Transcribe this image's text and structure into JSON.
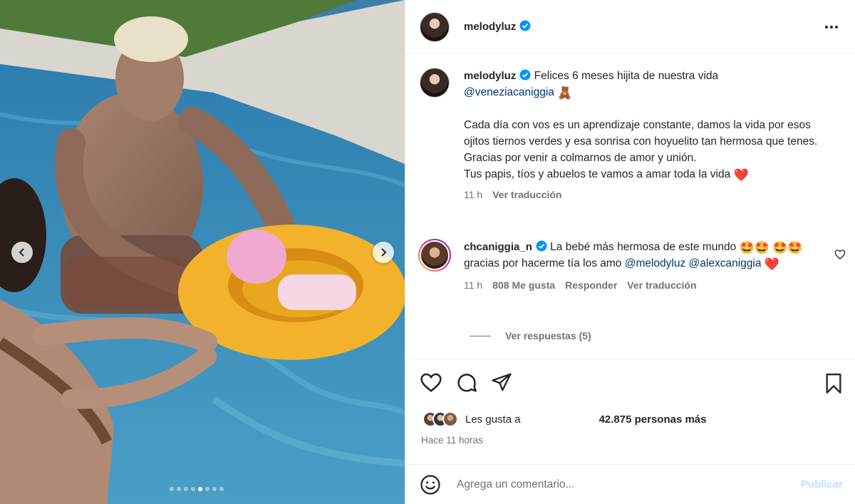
{
  "colors": {
    "link": "#00376b",
    "verified": "#0095f6",
    "like_heart": "#ed1c24",
    "muted": "#737373",
    "post_disabled": "#c0dffd"
  },
  "carousel": {
    "total": 8,
    "active_index": 4
  },
  "header": {
    "username": "melodyluz",
    "verified_icon": "verified-badge-icon",
    "more_icon": "more-options-icon"
  },
  "caption": {
    "username": "melodyluz",
    "line1": "Felices 6 meses hijita de nuestra vida",
    "mention": "@veneziacaniggia",
    "mention_emoji": "🧸",
    "para1": "Cada día con vos es un aprendizaje constante, damos la vida por esos ojitos tiernos verdes y esa sonrisa con hoyuelito tan hermosa que tenes. Gracias por venir a colmarnos de amor y unión.",
    "para2": "Tus papis, tíos y abuelos te vamos a amar toda la vida",
    "para2_emoji": "❤️",
    "time": "11 h",
    "translate": "Ver traducción"
  },
  "comment": {
    "username": "chcaniggia_n",
    "text1": "La bebé más hermosa de este mundo",
    "emojis1": "🤩🤩",
    "emojis2": "🤩🤩",
    "text2": "gracias por hacerme tía los amo",
    "mention1": "@melodyluz",
    "mention2": "@alexcaniggia",
    "end_emoji": "❤️",
    "time": "11 h",
    "likes": "808 Me gusta",
    "reply": "Responder",
    "translate": "Ver traducción",
    "view_replies": "Ver respuestas (5)"
  },
  "actions": {
    "like_icon": "heart-icon",
    "comment_icon": "comment-icon",
    "share_icon": "share-icon",
    "save_icon": "bookmark-icon"
  },
  "likes": {
    "prefix": "Les gusta a",
    "count_text": "42.875 personas más"
  },
  "posted": "Hace 11 horas",
  "add_comment": {
    "placeholder": "Agrega un comentario...",
    "post_label": "Publicar",
    "emoji_icon": "smiley-icon"
  }
}
